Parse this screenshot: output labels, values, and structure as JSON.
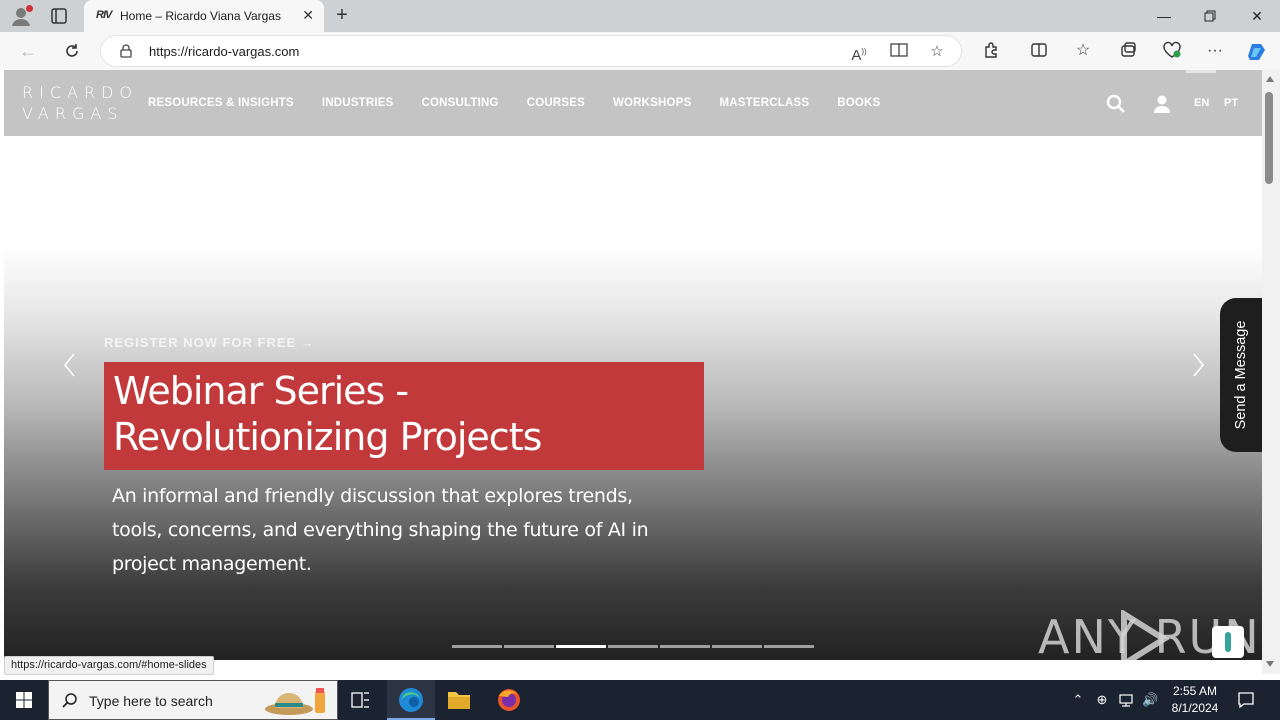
{
  "browser": {
    "tab": {
      "favicon_text": "RIV",
      "title": "Home – Ricardo Viana Vargas"
    },
    "address": {
      "url": "https://ricardo-vargas.com"
    },
    "status_url": "https://ricardo-vargas.com/#home-slides"
  },
  "site": {
    "logo": {
      "line1": "RICARDO",
      "line2": "VARGAS"
    },
    "nav": [
      "RESOURCES & INSIGHTS",
      "INDUSTRIES",
      "CONSULTING",
      "COURSES",
      "WORKSHOPS",
      "MASTERCLASS",
      "BOOKS"
    ],
    "lang": {
      "en": "EN",
      "pt": "PT"
    }
  },
  "hero": {
    "register": "REGISTER NOW FOR FREE →",
    "title": "Webinar Series - Revolutionizing Projects",
    "description": "An informal and friendly discussion that explores trends, tools, concerns, and everything shaping the future of AI in project management.",
    "slide_count": 7,
    "active_slide": 3
  },
  "widget": {
    "send_message": "Send a Message"
  },
  "watermark": {
    "text": "ANY  RUN"
  },
  "taskbar": {
    "search_placeholder": "Type here to search",
    "time": "2:55 AM",
    "date": "8/1/2024"
  },
  "colors": {
    "accent_red": "#c1393b",
    "header_gray": "#c4c4c4",
    "taskbar": "#1c2330"
  }
}
